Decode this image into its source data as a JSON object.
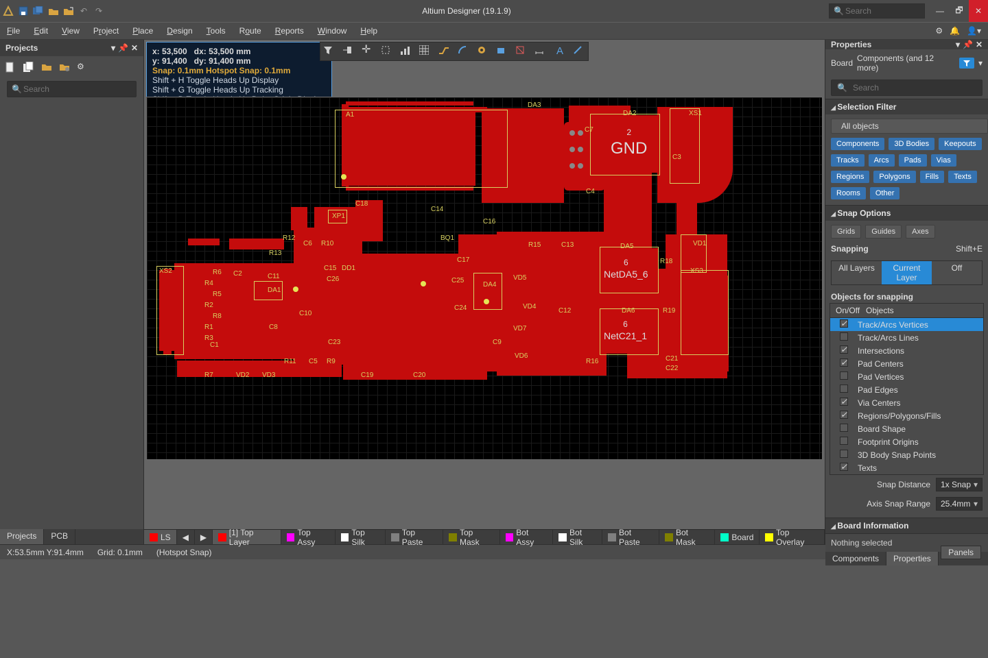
{
  "app": {
    "title": "Altium Designer (19.1.9)",
    "search_placeholder": "Search"
  },
  "menu": [
    "File",
    "Edit",
    "View",
    "Project",
    "Place",
    "Design",
    "Tools",
    "Route",
    "Reports",
    "Window",
    "Help"
  ],
  "projects": {
    "title": "Projects",
    "search_placeholder": "Search"
  },
  "headsup": {
    "x": "x: 53,500",
    "dx": "dx: 53,500 mm",
    "y": "y: 91,400",
    "dy": "dy: 91,400 mm",
    "snap": "Snap: 0.1mm Hotspot Snap: 0.1mm",
    "h1": "Shift + H  Toggle Heads Up Display",
    "h2": "Shift + G  Toggle Heads Up Tracking",
    "h3": "Shift + D  Toggle Heads Up Delta Origin Display"
  },
  "properties": {
    "title": "Properties",
    "scope": "Board",
    "scope_extra": "Components (and 12 more)",
    "search_placeholder": "Search",
    "sec_filter": "Selection Filter",
    "all_objects": "All objects",
    "filter_chips": [
      "Components",
      "3D Bodies",
      "Keepouts",
      "Tracks",
      "Arcs",
      "Pads",
      "Vias",
      "Regions",
      "Polygons",
      "Fills",
      "Texts",
      "Rooms",
      "Other"
    ],
    "sec_snap": "Snap Options",
    "snap_chips": [
      "Grids",
      "Guides",
      "Axes"
    ],
    "snapping_label": "Snapping",
    "snapping_shortcut": "Shift+E",
    "snap_modes": [
      "All Layers",
      "Current Layer",
      "Off"
    ],
    "snap_mode_active": 1,
    "objects_label": "Objects for snapping",
    "snap_head_onoff": "On/Off",
    "snap_head_obj": "Objects",
    "snap_rows": [
      {
        "on": true,
        "label": "Track/Arcs Vertices",
        "sel": true
      },
      {
        "on": false,
        "label": "Track/Arcs Lines"
      },
      {
        "on": true,
        "label": "Intersections"
      },
      {
        "on": true,
        "label": "Pad Centers"
      },
      {
        "on": false,
        "label": "Pad Vertices"
      },
      {
        "on": false,
        "label": "Pad Edges"
      },
      {
        "on": true,
        "label": "Via Centers"
      },
      {
        "on": true,
        "label": "Regions/Polygons/Fills"
      },
      {
        "on": false,
        "label": "Board Shape"
      },
      {
        "on": false,
        "label": "Footprint Origins"
      },
      {
        "on": false,
        "label": "3D Body Snap Points"
      },
      {
        "on": true,
        "label": "Texts"
      }
    ],
    "snap_distance_label": "Snap Distance",
    "snap_distance_value": "1x Snap",
    "axis_range_label": "Axis Snap Range",
    "axis_range_value": "25.4mm",
    "sec_board_info": "Board Information",
    "nothing": "Nothing selected"
  },
  "layer_tabs": {
    "ls": "LS",
    "items": [
      {
        "color": "#ff0000",
        "label": "[1] Top Layer",
        "active": true
      },
      {
        "color": "#ff00ff",
        "label": "Top Assy"
      },
      {
        "color": "#ffffff",
        "label": "Top Silk"
      },
      {
        "color": "#808080",
        "label": "Top Paste"
      },
      {
        "color": "#808000",
        "label": "Top Mask"
      },
      {
        "color": "#ff00ff",
        "label": "Bot Assy"
      },
      {
        "color": "#ffffff",
        "label": "Bot Silk"
      },
      {
        "color": "#808080",
        "label": "Bot Paste"
      },
      {
        "color": "#808000",
        "label": "Bot Mask"
      },
      {
        "color": "#00ffc8",
        "label": "Board"
      },
      {
        "color": "#ffff00",
        "label": "Top Overlay"
      }
    ]
  },
  "left_tabs": [
    "Projects",
    "PCB"
  ],
  "right_tabs": [
    "Components",
    "Properties"
  ],
  "status": {
    "coord": "X:53.5mm Y:91.4mm",
    "grid": "Grid: 0.1mm",
    "snap": "(Hotspot Snap)",
    "panels": "Panels"
  },
  "nets": {
    "gnd_num": "2",
    "gnd": "GND",
    "da5_num": "6",
    "da5": "NetDA5_6",
    "c21_num": "6",
    "c21": "NetC21_1"
  },
  "silk": [
    "A1",
    "DA3",
    "DA2",
    "XS1",
    "C7",
    "C3",
    "C4",
    "C18",
    "C14",
    "XP1",
    "C16",
    "BQ1",
    "R12",
    "C6",
    "R10",
    "R15",
    "C13",
    "DA5",
    "R13",
    "C17",
    "R18",
    "XS2",
    "R6",
    "C2",
    "C11",
    "C15",
    "DD1",
    "C25",
    "DA4",
    "VD5",
    "R4",
    "C26",
    "R5",
    "DA1",
    "R2",
    "C12",
    "DA6",
    "R19",
    "VD4",
    "R8",
    "C24",
    "C10",
    "C8",
    "C1",
    "C23",
    "VD7",
    "C9",
    "R16",
    "C21",
    "R11",
    "C5",
    "R9",
    "VD6",
    "C22",
    "R3",
    "R1",
    "R7",
    "VD2",
    "VD3",
    "C19",
    "C20",
    "XS3",
    "VD1"
  ]
}
